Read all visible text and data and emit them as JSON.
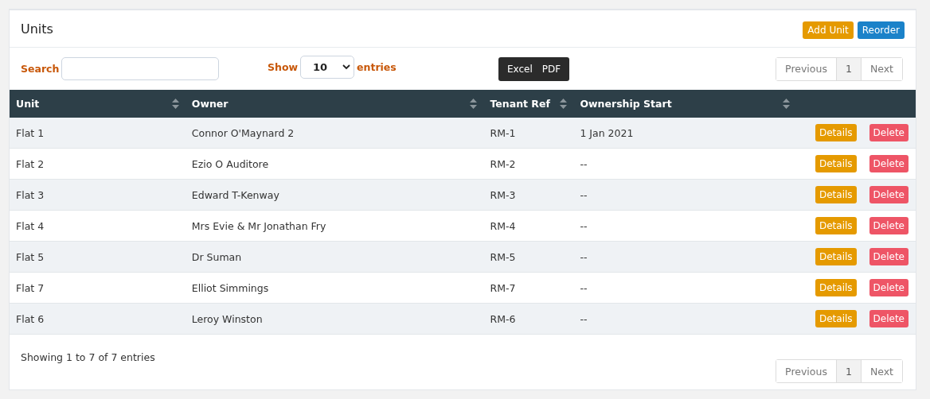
{
  "card": {
    "title": "Units",
    "actions": [
      {
        "label": "Add Unit",
        "kind": "warning"
      },
      {
        "label": "Reorder",
        "kind": "primary"
      }
    ]
  },
  "search": {
    "label": "Search"
  },
  "length": {
    "prefix": "Show",
    "value": "10",
    "suffix": "entries"
  },
  "export_buttons": [
    "Excel",
    "PDF"
  ],
  "pagination_top": {
    "previous": "Previous",
    "pages": [
      {
        "label": "1",
        "selected": true
      }
    ],
    "next": "Next"
  },
  "table": {
    "columns": [
      "Unit",
      "Owner",
      "Tenant Ref",
      "Ownership Start"
    ],
    "rows": [
      {
        "unit": "Flat 1",
        "owner": "Connor O'Maynard 2",
        "tenant_ref": "RM-1",
        "ownership_start": "1 Jan 2021",
        "actions": [
          "Details",
          "Delete"
        ]
      },
      {
        "unit": "Flat 2",
        "owner": "Ezio O Auditore",
        "tenant_ref": "RM-2",
        "ownership_start": "--",
        "actions": [
          "Details",
          "Delete"
        ]
      },
      {
        "unit": "Flat 3",
        "owner": "Edward T-Kenway",
        "tenant_ref": "RM-3",
        "ownership_start": "--",
        "actions": [
          "Details",
          "Delete"
        ]
      },
      {
        "unit": "Flat 4",
        "owner": "Mrs Evie & Mr Jonathan Fry",
        "tenant_ref": "RM-4",
        "ownership_start": "--",
        "actions": [
          "Details",
          "Delete"
        ]
      },
      {
        "unit": "Flat 5",
        "owner": "Dr Suman",
        "tenant_ref": "RM-5",
        "ownership_start": "--",
        "actions": [
          "Details",
          "Delete"
        ]
      },
      {
        "unit": "Flat 7",
        "owner": "Elliot Simmings",
        "tenant_ref": "RM-7",
        "ownership_start": "--",
        "actions": [
          "Details",
          "Delete"
        ]
      },
      {
        "unit": "Flat 6",
        "owner": "Leroy Winston",
        "tenant_ref": "RM-6",
        "ownership_start": "--",
        "actions": [
          "Details",
          "Delete"
        ]
      }
    ]
  },
  "info": "Showing 1 to 7 of 7 entries",
  "pagination_bottom": {
    "previous": "Previous",
    "pages": [
      {
        "label": "1",
        "selected": true
      }
    ],
    "next": "Next"
  }
}
